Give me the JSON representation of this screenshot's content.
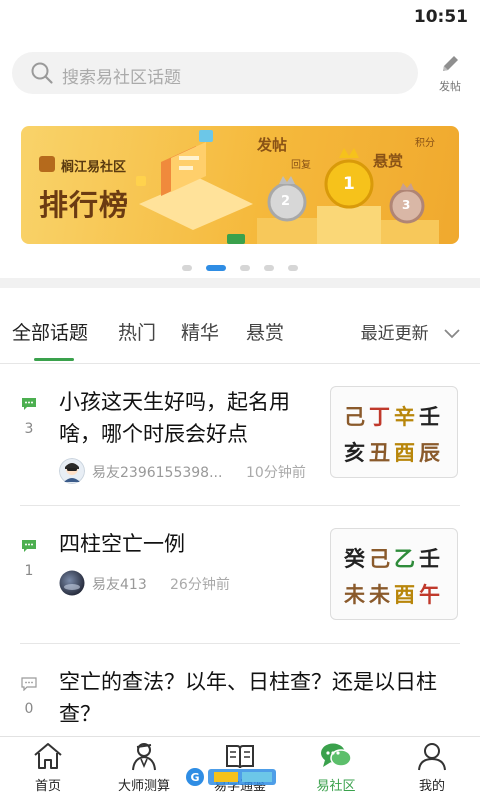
{
  "status_bar": {
    "time": "10:51"
  },
  "search": {
    "placeholder": "搜索易社区话题",
    "post_label": "发帖"
  },
  "banner": {
    "logo_text": "榈江易社区",
    "title": "排行榜",
    "labels": {
      "post": "发帖",
      "reply": "回复",
      "reward": "悬赏",
      "points": "积分"
    },
    "medals": [
      "1",
      "2",
      "3"
    ]
  },
  "carousel": {
    "count": 5,
    "active_index": 1
  },
  "tabs": [
    {
      "label": "全部话题",
      "active": true
    },
    {
      "label": "热门",
      "active": false
    },
    {
      "label": "精华",
      "active": false
    },
    {
      "label": "悬赏",
      "active": false
    }
  ],
  "sort": {
    "label": "最近更新"
  },
  "posts": [
    {
      "title": "小孩这天生好吗，起名用啥，哪个时辰会好点",
      "count": "3",
      "author": "易友2396155398...",
      "time": "10分钟前",
      "bazi": {
        "top": [
          "己",
          "丁",
          "辛",
          "壬"
        ],
        "bottom": [
          "亥",
          "丑",
          "酉",
          "辰"
        ],
        "top_colors": [
          "#8a5a2b",
          "#c0392b",
          "#b8860b",
          "#222222"
        ],
        "bottom_colors": [
          "#222222",
          "#8a5a2b",
          "#b8860b",
          "#8a5a2b"
        ]
      }
    },
    {
      "title": "四柱空亡一例",
      "count": "1",
      "author": "易友413",
      "time": "26分钟前",
      "bazi": {
        "top": [
          "癸",
          "己",
          "乙",
          "壬"
        ],
        "bottom": [
          "未",
          "未",
          "酉",
          "午"
        ],
        "top_colors": [
          "#222222",
          "#8a5a2b",
          "#2e8b3a",
          "#222222"
        ],
        "bottom_colors": [
          "#8a5a2b",
          "#8a5a2b",
          "#b8860b",
          "#c0392b"
        ]
      }
    },
    {
      "title": "空亡的查法？以年、日柱查？还是以日柱查？",
      "count": "0"
    }
  ],
  "bottom_nav": [
    {
      "label": "首页",
      "icon": "home-icon",
      "active": false
    },
    {
      "label": "大师测算",
      "icon": "master-icon",
      "active": false
    },
    {
      "label": "易学通鉴",
      "icon": "book-icon",
      "active": false
    },
    {
      "label": "易社区",
      "icon": "community-icon",
      "active": true
    },
    {
      "label": "我的",
      "icon": "profile-icon",
      "active": false
    }
  ],
  "colors": {
    "accent": "#3aa14c",
    "dot_active": "#2f8de4"
  }
}
